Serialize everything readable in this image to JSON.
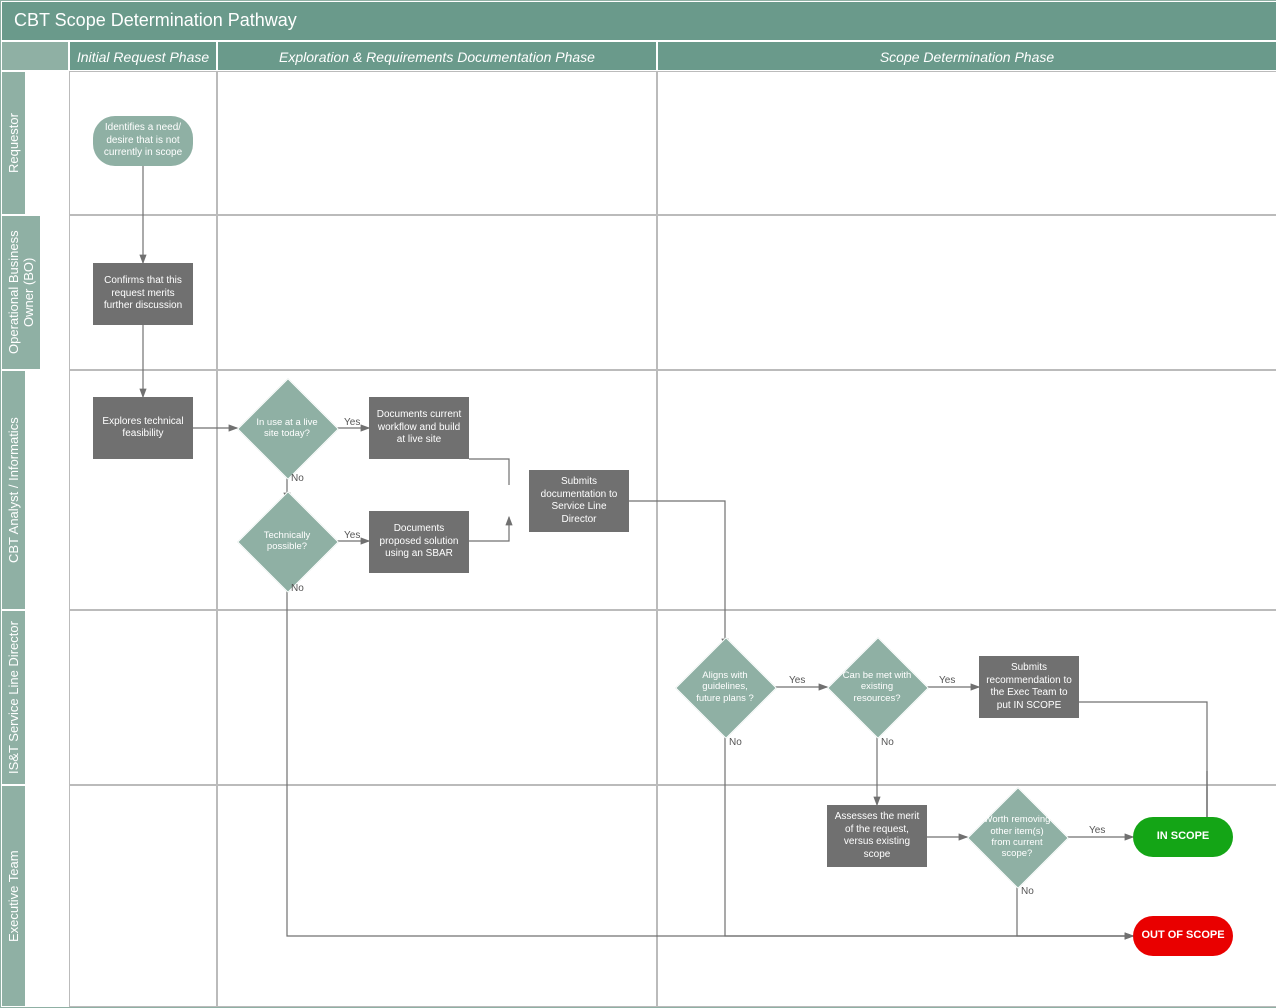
{
  "title": "CBT Scope Determination Pathway",
  "phases": {
    "p1": "Initial Request Phase",
    "p2": "Exploration & Requirements Documentation Phase",
    "p3": "Scope Determination Phase"
  },
  "lanes": {
    "l1": "Requestor",
    "l2": "Operational Business Owner (BO)",
    "l3": "CBT Analyst / Informatics",
    "l4": "IS&T Service Line Director",
    "l5": "Executive Team"
  },
  "nodes": {
    "start": "Identifies a need/ desire that is not currently in scope",
    "confirms": "Confirms that this request merits further discussion",
    "explores": "Explores technical feasibility",
    "livesite": "In use at a live site today?",
    "docLive": "Documents current workflow and build at live site",
    "techPossible": "Technically possible?",
    "docSBAR": "Documents proposed solution using an SBAR",
    "submitsSLD": "Submits documentation to Service Line Director",
    "aligns": "Aligns with guidelines, future plans ?",
    "resources": "Can be met with existing resources?",
    "submitRec": "Submits recommendation to the Exec Team to put IN SCOPE",
    "assess": "Assesses the merit of the request, versus existing scope",
    "worthRemove": "Worth removing other item(s) from current scope?",
    "inScope": "IN SCOPE",
    "outScope": "OUT OF SCOPE"
  },
  "labels": {
    "yes": "Yes",
    "no": "No"
  }
}
